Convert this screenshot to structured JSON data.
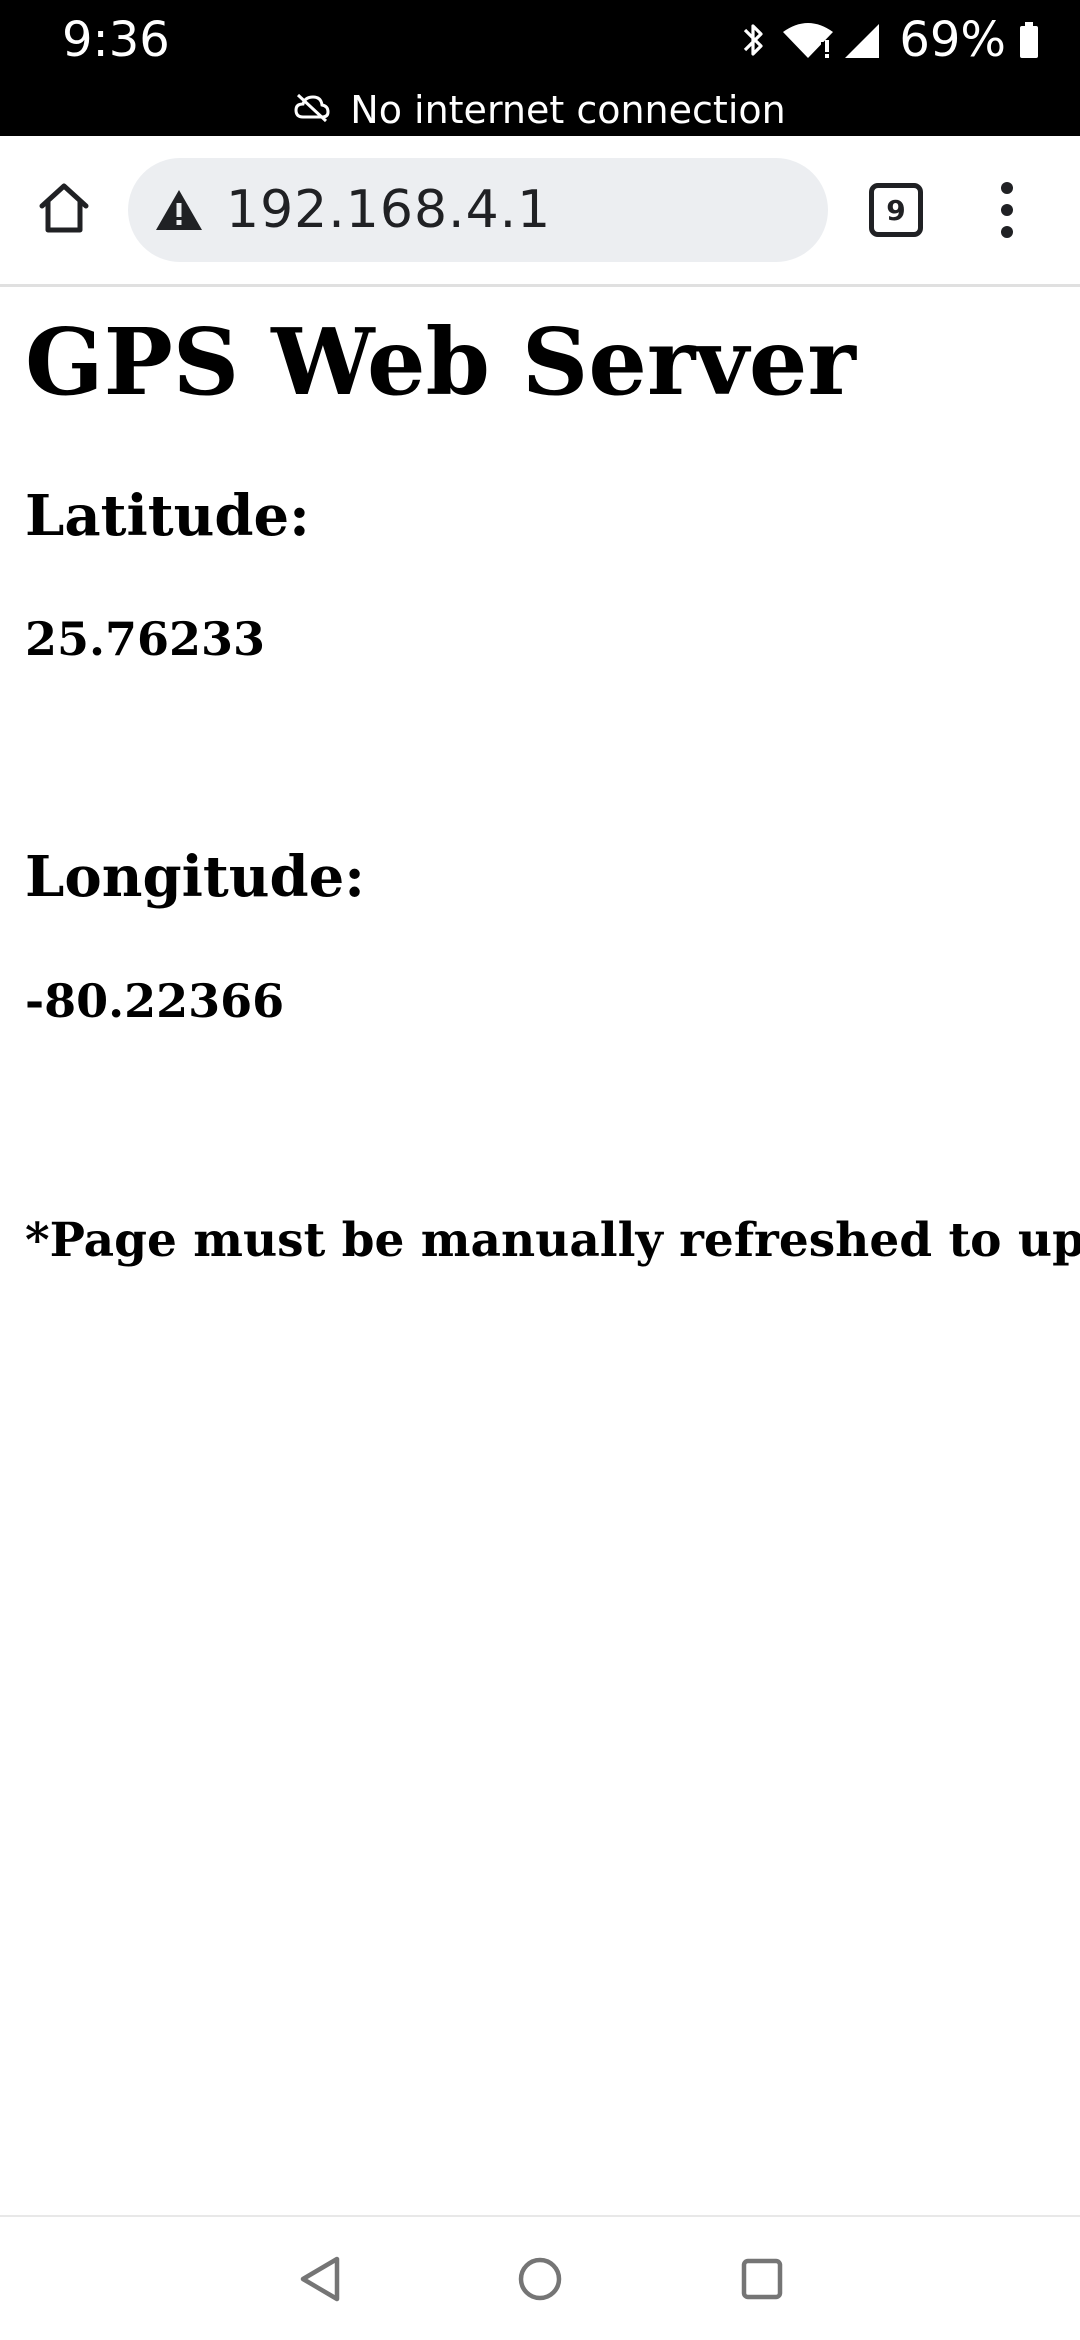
{
  "status_bar": {
    "time": "9:36",
    "battery": "69%",
    "connection_notice": "No internet connection",
    "icons": [
      "bluetooth-icon",
      "wifi-icon",
      "cell-signal-icon",
      "battery-icon"
    ]
  },
  "browser": {
    "url": "192.168.4.1",
    "tab_count": "9",
    "icons": [
      "home-icon",
      "warning-icon",
      "tab-switcher-icon",
      "more-vert-icon"
    ]
  },
  "page": {
    "title": "GPS Web Server",
    "latitude_label": "Latitude:",
    "latitude_value": "25.76233",
    "longitude_label": "Longitude:",
    "longitude_value": "-80.22366",
    "refresh_note": "*Page must be manually refreshed to updat"
  },
  "nav_bar": {
    "icons": [
      "back-icon",
      "home-circle-icon",
      "recents-icon"
    ]
  },
  "colors": {
    "status_bar_bg": "#000000",
    "omnibox_bg": "#eceef1",
    "icon_dark": "#202124"
  }
}
